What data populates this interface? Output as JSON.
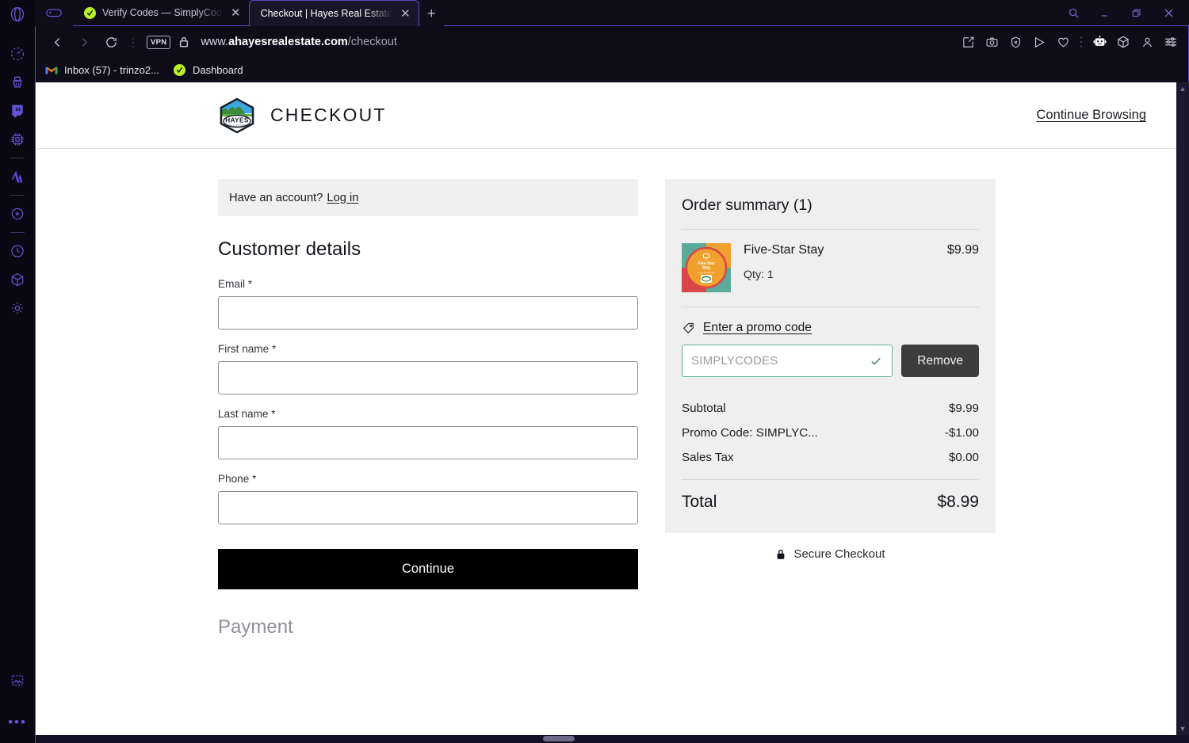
{
  "browser": {
    "window_controls": [
      {
        "name": "search",
        "glyph": "search-icon"
      },
      {
        "name": "minimize",
        "glyph": "minimize-icon"
      },
      {
        "name": "restore",
        "glyph": "restore-icon"
      },
      {
        "name": "close",
        "glyph": "close-icon"
      }
    ],
    "tabs": [
      {
        "title": "Verify Codes — SimplyCodes",
        "active": false,
        "favicon": "simplycodes-icon"
      },
      {
        "title": "Checkout | Hayes Real Estate",
        "active": true,
        "favicon": "none"
      }
    ],
    "new_tab_label": "+",
    "nav": {
      "back_label": "Back",
      "forward_label": "Forward",
      "reload_label": "Reload",
      "vpn_badge": "VPN",
      "url_protocol": "www.",
      "url_domain": "ahayesrealestate.com",
      "url_path": "/checkout"
    },
    "toolbar_icons": [
      "edit-page-icon",
      "camera-snapshot-icon",
      "shield-ad-block-icon",
      "send-flow-icon",
      "heart-favorites-icon",
      "vertical-dots-icon",
      "ai-assistant-robot-icon",
      "cube-workspace-icon",
      "profile-person-icon",
      "settings-sliders-icon"
    ],
    "bookmarks": [
      {
        "label": "Inbox (57) - trinzo2...",
        "icon": "gmail-icon"
      },
      {
        "label": "Dashboard",
        "icon": "simplycodes-icon"
      }
    ]
  },
  "sidebar": {
    "items": [
      {
        "name": "speed-dial",
        "icon": "speedometer-icon"
      },
      {
        "name": "cleaner",
        "icon": "broom-icon"
      },
      {
        "name": "twitch",
        "icon": "twitch-icon"
      },
      {
        "name": "cpu-monitor",
        "icon": "chip-icon"
      },
      {
        "name": "aria-ai",
        "icon": "aria-icon"
      },
      {
        "name": "player",
        "icon": "play-circle-icon"
      },
      {
        "name": "history",
        "icon": "clock-icon"
      },
      {
        "name": "extensions",
        "icon": "cube-icon"
      },
      {
        "name": "settings",
        "icon": "gear-icon"
      },
      {
        "name": "image-capture",
        "icon": "image-icon"
      },
      {
        "name": "more",
        "icon": "ellipsis-icon"
      }
    ]
  },
  "header": {
    "logo_alt": "Hayes Real Estate",
    "logo_text_main": "HAYES",
    "logo_text_sub": "REAL ESTATE",
    "title": "CHECKOUT",
    "continue_browsing_label": "Continue Browsing"
  },
  "account_prompt": {
    "text": "Have an account?",
    "link_label": "Log in"
  },
  "customer_details": {
    "title": "Customer details",
    "fields": [
      {
        "label": "Email *",
        "value": "",
        "placeholder": "",
        "name": "email-field"
      },
      {
        "label": "First name *",
        "value": "",
        "placeholder": "",
        "name": "first-name-field"
      },
      {
        "label": "Last name *",
        "value": "",
        "placeholder": "",
        "name": "last-name-field"
      },
      {
        "label": "Phone *",
        "value": "",
        "placeholder": "",
        "name": "phone-field"
      }
    ],
    "continue_label": "Continue"
  },
  "payment_section": {
    "title": "Payment"
  },
  "order_summary": {
    "heading": "Order summary",
    "count": "(1)",
    "items": [
      {
        "name": "Five-Star Stay",
        "qty_label": "Qty: 1",
        "price": "$9.99",
        "thumb_title": "Five-Star Stay"
      }
    ],
    "promo": {
      "link_label": "Enter a promo code",
      "tag_icon": "price-tag-icon",
      "input_value": "SIMPLYCODES",
      "applied": true,
      "check_icon": "check-icon",
      "remove_label": "Remove"
    },
    "totals": [
      {
        "label": "Subtotal",
        "value": "$9.99"
      },
      {
        "label": "Promo Code: SIMPLYC...",
        "value": "-$1.00"
      },
      {
        "label": "Sales Tax",
        "value": "$0.00"
      }
    ],
    "grand_total": {
      "label": "Total",
      "value": "$8.99"
    },
    "secure_label": "Secure Checkout",
    "secure_icon": "lock-icon"
  },
  "colors": {
    "accent_purple": "#5b49c9",
    "page_bg": "#ffffff",
    "summary_bg": "#efefef",
    "promo_border_green": "#63b08e",
    "button_black": "#000000",
    "remove_gray": "#3d3d3d"
  }
}
